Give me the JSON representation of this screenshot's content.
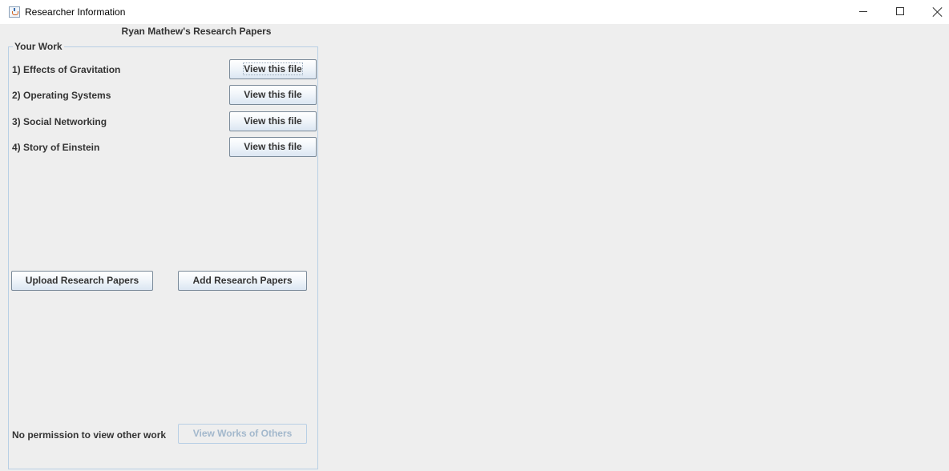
{
  "window": {
    "title": "Researcher Information",
    "controls": [
      "minimize-icon",
      "maximize-icon",
      "close-icon"
    ]
  },
  "page": {
    "heading": "Ryan Mathew's Research Papers"
  },
  "your_work": {
    "group_title": "Your Work",
    "papers": [
      {
        "label": "1) Effects of Gravitation",
        "button": "View this file"
      },
      {
        "label": "2) Operating Systems",
        "button": "View this file"
      },
      {
        "label": "3) Social Networking",
        "button": "View this file"
      },
      {
        "label": "4) Story of Einstein",
        "button": "View this file"
      }
    ],
    "upload_button": "Upload Research Papers",
    "add_button": "Add Research Papers"
  },
  "others": {
    "permission_text": "No permission to view other work",
    "view_others_button": "View Works of Others",
    "view_others_enabled": false
  },
  "colors": {
    "background": "#eeeeee",
    "titlebar": "#ffffff",
    "group_border": "#b8cfe5",
    "text": "#333333",
    "disabled_text": "#a3b8cc"
  }
}
